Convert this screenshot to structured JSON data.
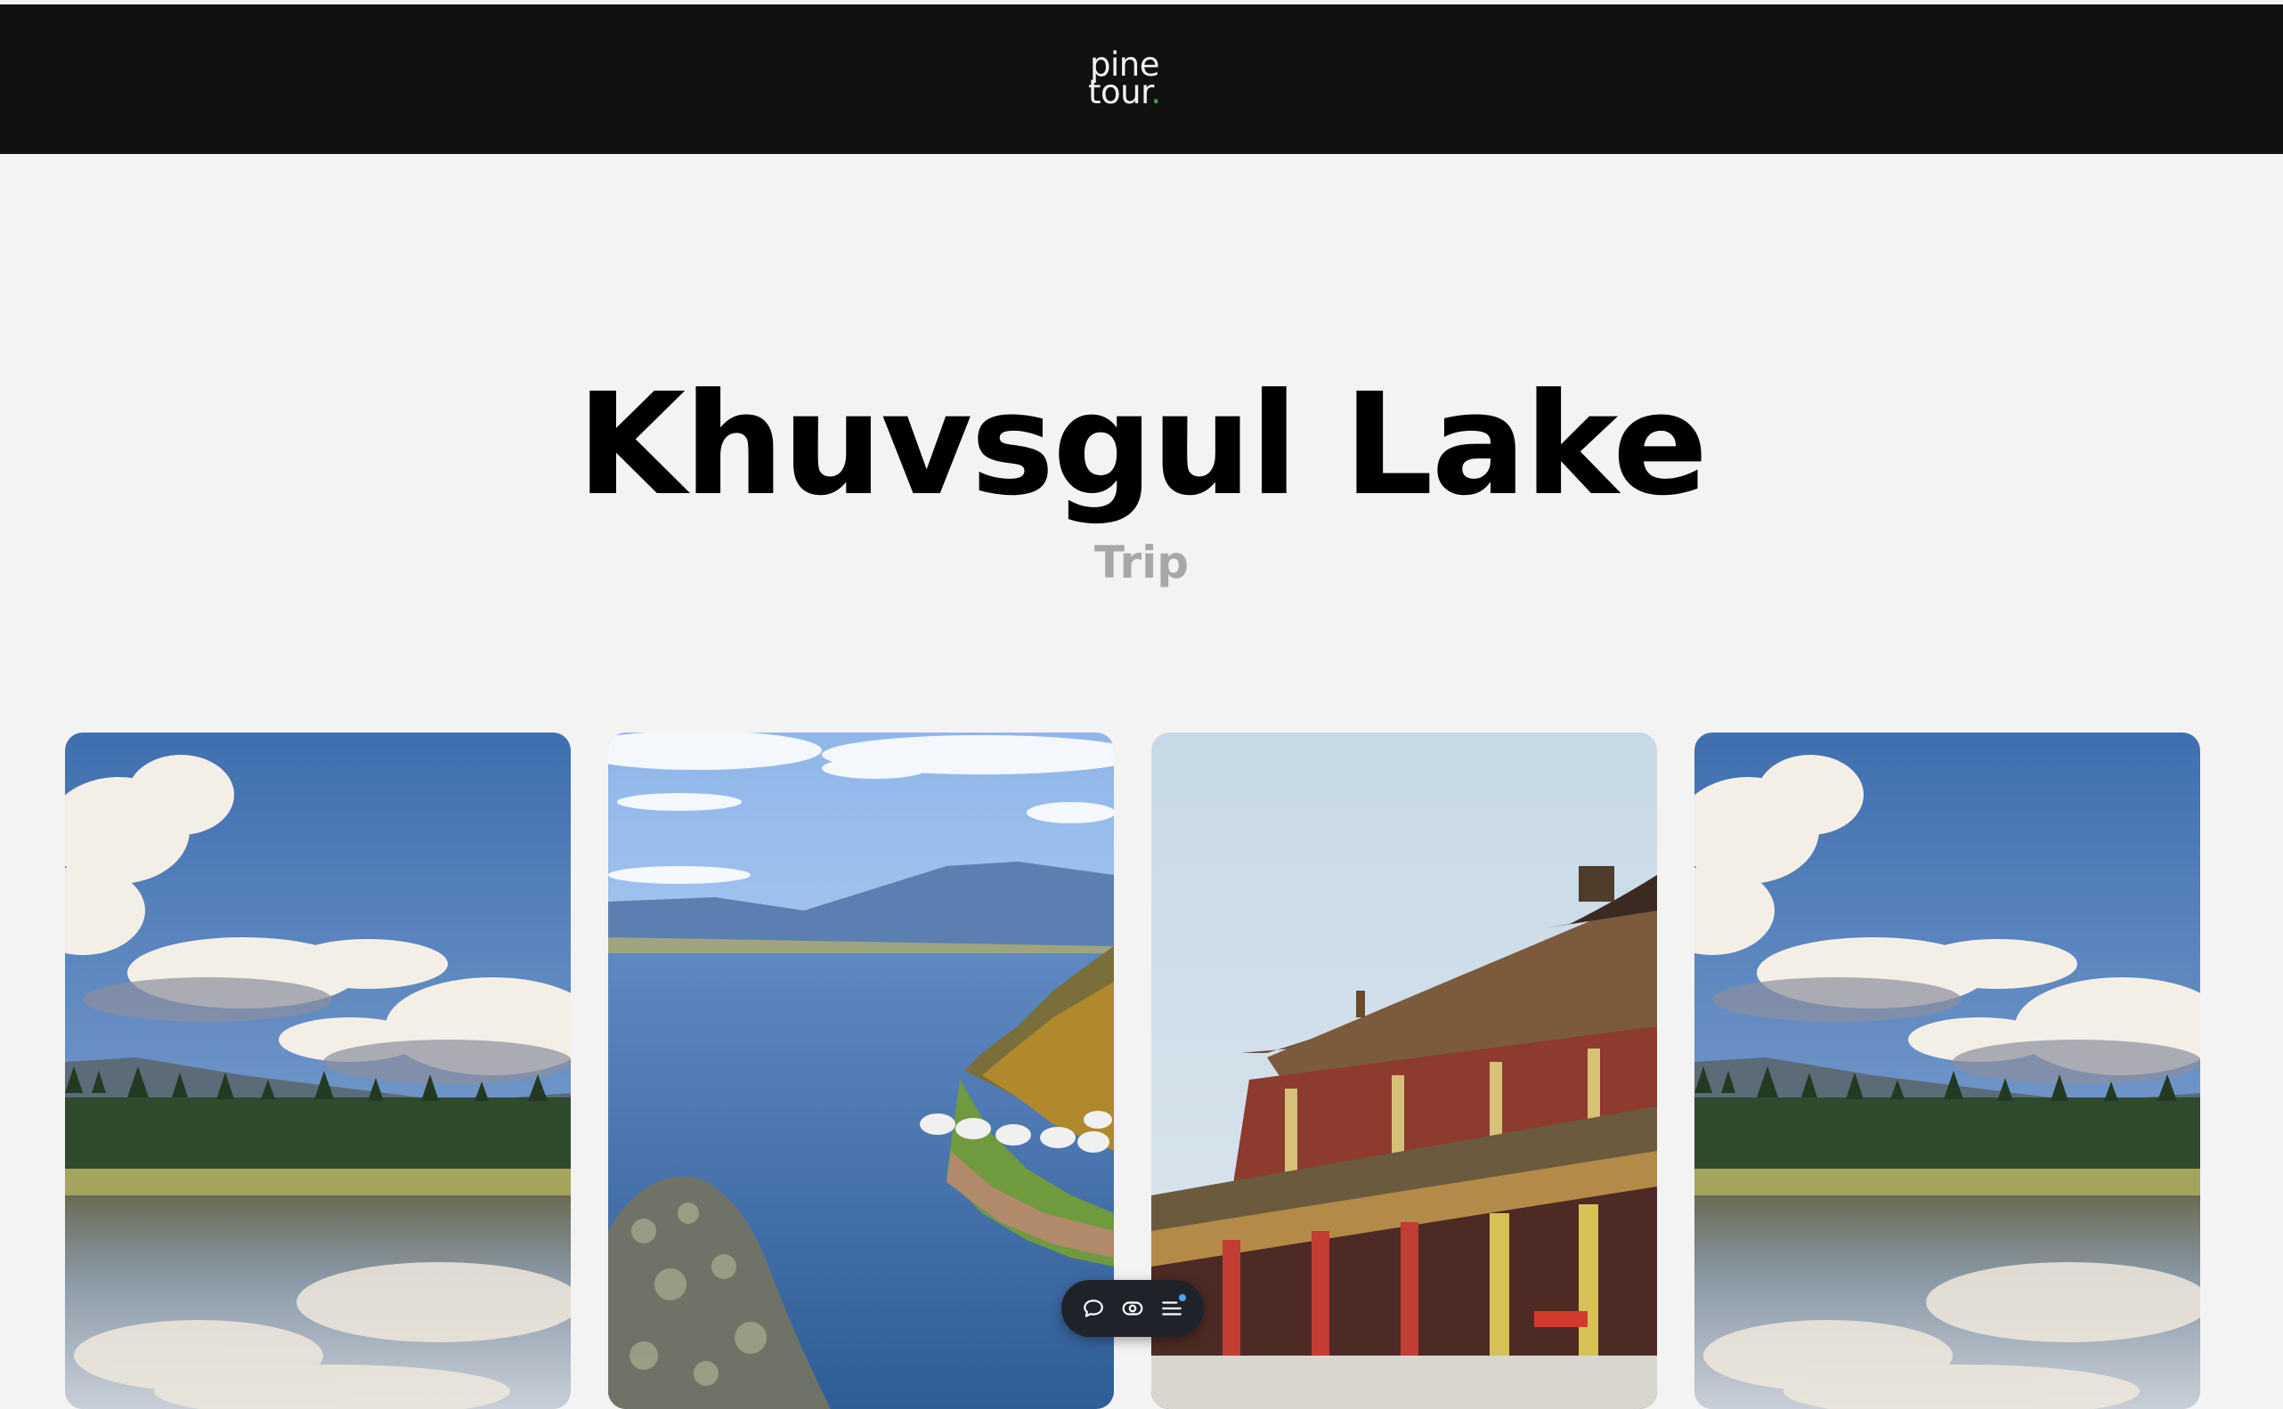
{
  "header": {
    "logo_line1": "pine",
    "logo_line2": "tour",
    "logo_dot": ".",
    "background": "#111111",
    "accent": "#3fa541"
  },
  "hero": {
    "title": "Khuvsgul Lake",
    "subtitle": "Trip"
  },
  "gallery": {
    "cards": [
      {
        "subject": "lake-reflection-clouds-forest"
      },
      {
        "subject": "lake-shore-gers-hills"
      },
      {
        "subject": "monastery-temple-roof"
      },
      {
        "subject": "lake-reflection-clouds-forest"
      }
    ]
  },
  "toolbar": {
    "buttons": [
      {
        "icon": "comment-icon"
      },
      {
        "icon": "eye-icon"
      },
      {
        "icon": "menu-list-icon"
      }
    ],
    "badge_color": "#4aa3ff"
  }
}
